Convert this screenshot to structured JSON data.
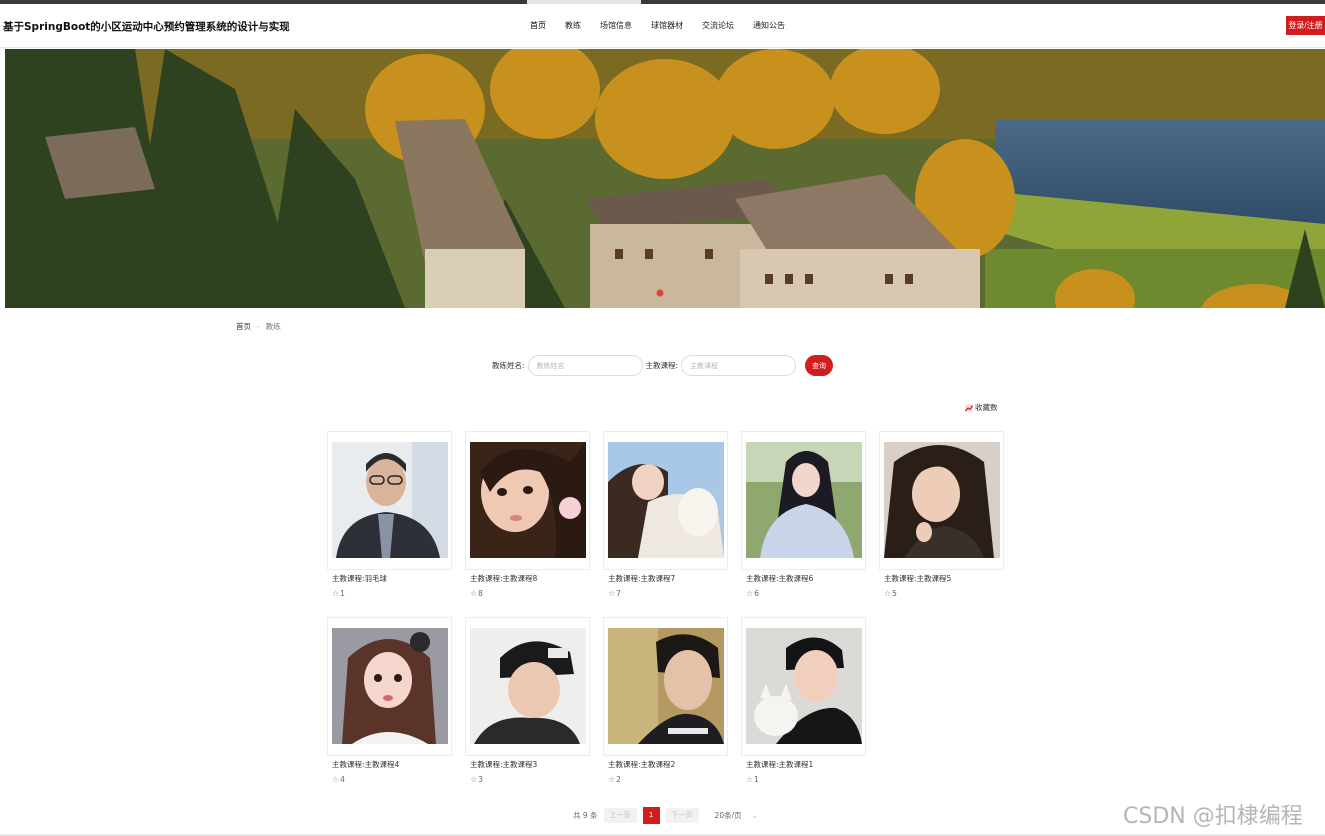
{
  "header": {
    "title": "基于SpringBoot的小区运动中心预约管理系统的设计与实现",
    "nav": [
      {
        "label": "首页"
      },
      {
        "label": "教练"
      },
      {
        "label": "场馆信息"
      },
      {
        "label": "球馆器材"
      },
      {
        "label": "交流论坛"
      },
      {
        "label": "通知公告"
      }
    ],
    "login_label": "登录/注册"
  },
  "breadcrumb": {
    "home": "首页",
    "sep": "-",
    "current": "教练"
  },
  "search": {
    "name_label": "教练姓名:",
    "name_placeholder": "教练姓名",
    "course_label": "主教课程:",
    "course_placeholder": "主教课程",
    "button": "查询"
  },
  "sort": {
    "label": "收藏数",
    "icon": "trend-icon"
  },
  "cards": [
    {
      "title": "主教课程:羽毛球",
      "likes": "1"
    },
    {
      "title": "主教课程:主教课程8",
      "likes": "8"
    },
    {
      "title": "主教课程:主教课程7",
      "likes": "7"
    },
    {
      "title": "主教课程:主教课程6",
      "likes": "6"
    },
    {
      "title": "主教课程:主教课程5",
      "likes": "5"
    },
    {
      "title": "主教课程:主教课程4",
      "likes": "4"
    },
    {
      "title": "主教课程:主教课程3",
      "likes": "3"
    },
    {
      "title": "主教课程:主教课程2",
      "likes": "2"
    },
    {
      "title": "主教课程:主教课程1",
      "likes": "1"
    }
  ],
  "pager": {
    "total": "共 9 条",
    "prev": "上一页",
    "current": "1",
    "next": "下一页",
    "size": "20条/页",
    "chevron": "⌄"
  },
  "watermark": "CSDN @扣棣编程",
  "colors": {
    "accent": "#d11d1d"
  }
}
